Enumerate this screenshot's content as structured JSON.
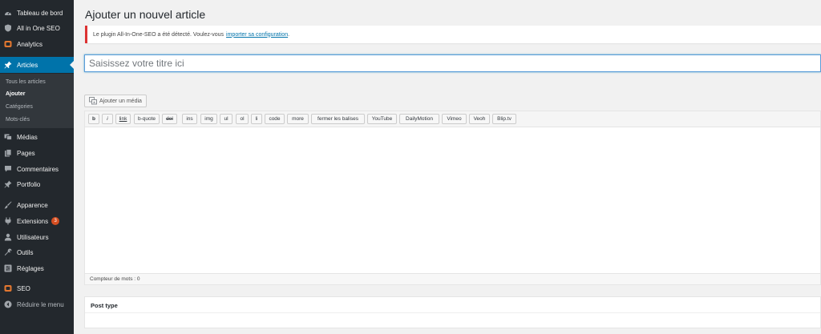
{
  "sidebar": {
    "items": [
      {
        "label": "Tableau de bord",
        "icon": "dashboard-icon"
      },
      {
        "label": "All in One SEO",
        "icon": "shield-icon"
      },
      {
        "label": "Analytics",
        "icon": "analytics-icon"
      },
      {
        "label": "Articles",
        "icon": "pin-icon"
      },
      {
        "label": "Médias",
        "icon": "media-icon"
      },
      {
        "label": "Pages",
        "icon": "pages-icon"
      },
      {
        "label": "Commentaires",
        "icon": "comment-icon"
      },
      {
        "label": "Portfolio",
        "icon": "pin-icon"
      },
      {
        "label": "Apparence",
        "icon": "brush-icon"
      },
      {
        "label": "Extensions",
        "icon": "plugin-icon",
        "badge": "3"
      },
      {
        "label": "Utilisateurs",
        "icon": "user-icon"
      },
      {
        "label": "Outils",
        "icon": "wrench-icon"
      },
      {
        "label": "Réglages",
        "icon": "settings-icon"
      },
      {
        "label": "SEO",
        "icon": "seo-icon"
      },
      {
        "label": "Réduire le menu",
        "icon": "collapse-icon"
      }
    ],
    "submenu": [
      "Tous les articles",
      "Ajouter",
      "Catégories",
      "Mots-clés"
    ]
  },
  "page": {
    "title": "Ajouter un nouvel article",
    "notice_text": "Le plugin All-In-One-SEO a été détecté. Voulez-vous",
    "notice_link": "importer sa configuration",
    "notice_tail": ".",
    "title_placeholder": "Saisissez votre titre ici"
  },
  "editor": {
    "add_media_label": "Ajouter un média",
    "buttons": [
      "b",
      "i",
      "link",
      "b-quote",
      "del",
      "ins",
      "img",
      "ul",
      "ol",
      "li",
      "code",
      "more",
      "fermer les balises",
      "YouTube",
      "DailyMotion",
      "Vimeo",
      "Veoh",
      "Blip.tv"
    ],
    "word_count": "Compteur de mots : 0"
  },
  "metabox": {
    "post_type_title": "Post type"
  },
  "colors": {
    "sidebar_bg": "#23282d",
    "active_bg": "#0073aa",
    "notice_border": "#dc3232",
    "badge_bg": "#d54e21"
  }
}
